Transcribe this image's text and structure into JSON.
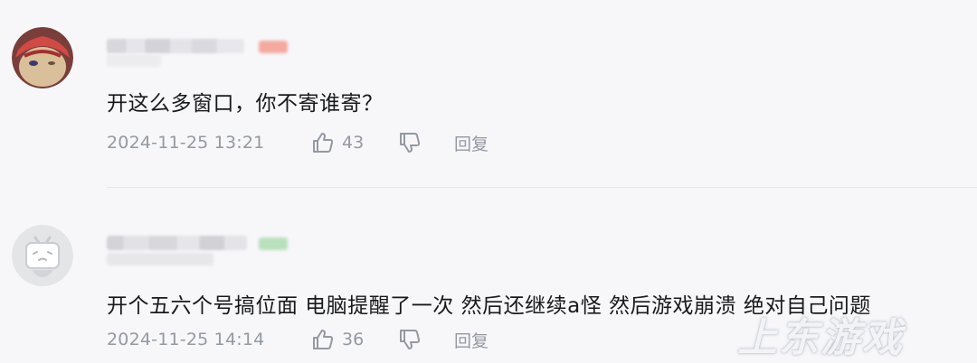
{
  "comments": [
    {
      "text": "开这么多窗口，你不寄谁寄？",
      "time": "2024-11-25 13:21",
      "likes": "43",
      "reply_label": "回复",
      "avatar_style": "red-character"
    },
    {
      "text": "开个五六个号搞位面 电脑提醒了一次 然后还继续a怪 然后游戏崩溃 绝对自己问题",
      "time": "2024-11-25 14:14",
      "likes": "36",
      "reply_label": "回复",
      "avatar_style": "default-tv"
    }
  ],
  "watermark": "上东游戏",
  "icons": {
    "like": "thumbs-up-icon",
    "dislike": "thumbs-down-icon"
  },
  "colors": {
    "background": "#f7f7fa",
    "meta_text": "#9499a0",
    "body_text": "#18191c"
  }
}
